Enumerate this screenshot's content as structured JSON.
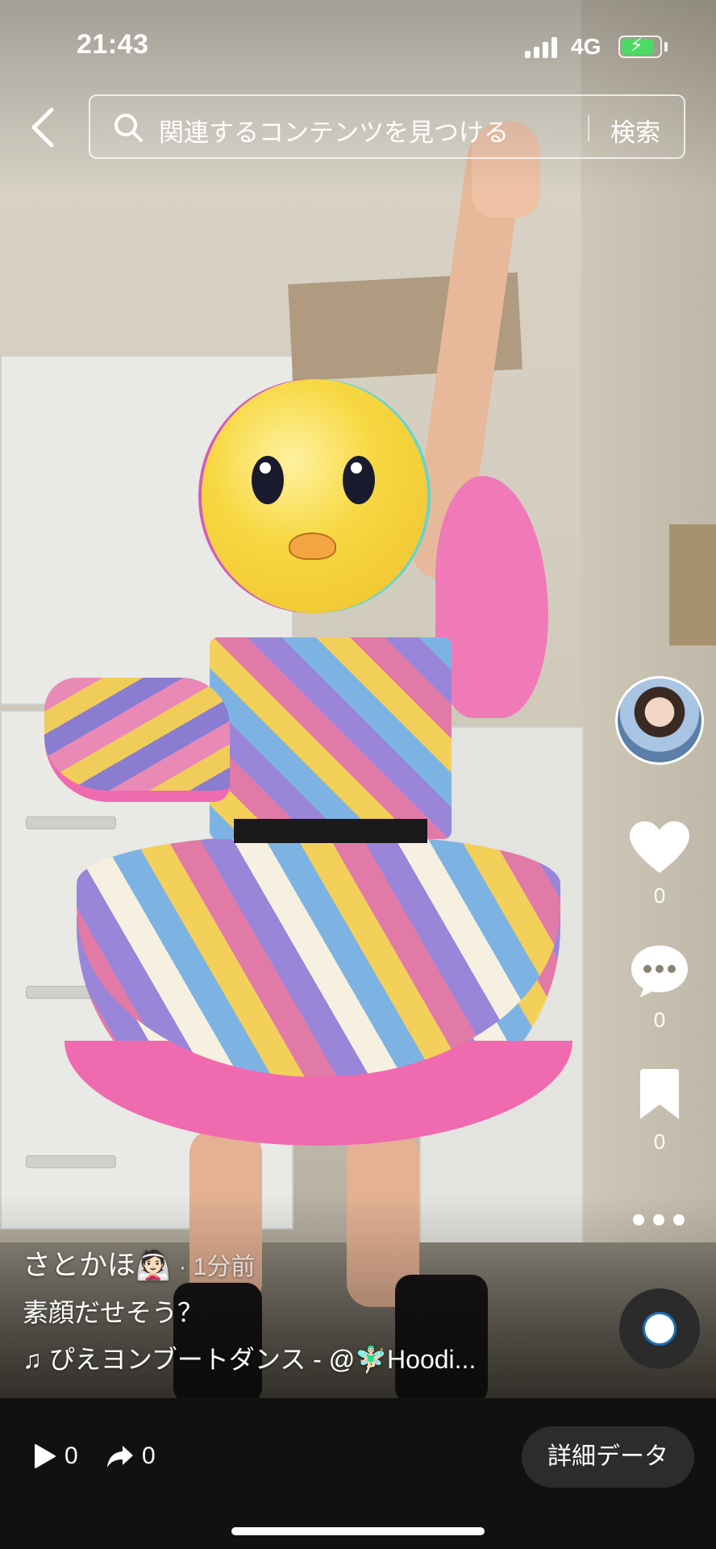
{
  "status_bar": {
    "time": "21:43",
    "network": "4G",
    "battery_level": 0.85,
    "charging": true
  },
  "search": {
    "placeholder": "関連するコンテンツを見つける",
    "button_label": "検索"
  },
  "rail": {
    "likes": "0",
    "comments": "0",
    "bookmarks": "0"
  },
  "caption": {
    "username": "さとかほ👰🏻",
    "posted": "· 1分前",
    "text": "素顔だせそう？",
    "music": "♫ ぴえヨンブートダンス - @🧚🏻‍♂️Hoodi..."
  },
  "bottom": {
    "plays": "0",
    "shares": "0",
    "detail_label": "詳細データ"
  },
  "colors": {
    "accent_pink": "#f06ab0",
    "battery_green": "#4cd964",
    "bar_bg": "#111111"
  },
  "icons": [
    "back-arrow-icon",
    "search-icon",
    "heart-icon",
    "comment-icon",
    "bookmark-icon",
    "more-icon",
    "play-icon",
    "share-icon",
    "music-note-icon"
  ]
}
